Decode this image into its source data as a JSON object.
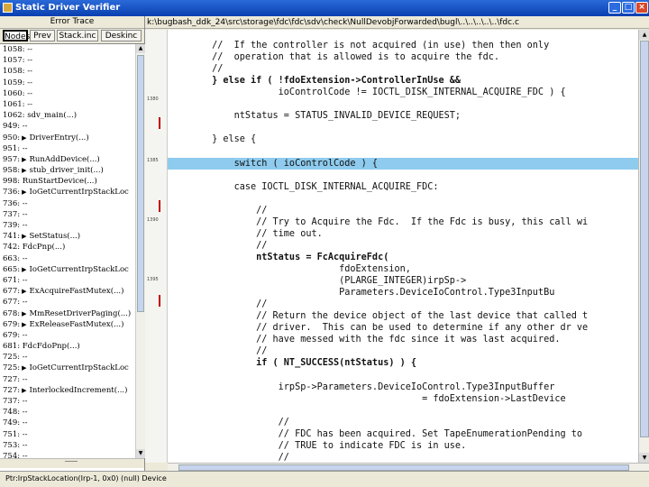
{
  "window": {
    "title": "Static Driver Verifier",
    "min_label": "_",
    "max_label": "□",
    "close_label": "×"
  },
  "left_panel": {
    "header": "Error Trace",
    "tabs": [
      {
        "label": "Nodes",
        "active": true
      },
      {
        "label": "Prev",
        "active": false
      },
      {
        "label": "Stack.inc",
        "active": false
      },
      {
        "label": "Deskinc",
        "active": false
      }
    ],
    "trace": [
      {
        "text": "1058: --",
        "arrow": false
      },
      {
        "text": "1057: --",
        "arrow": false
      },
      {
        "text": "1058: --",
        "arrow": false
      },
      {
        "text": "1059: --",
        "arrow": false
      },
      {
        "text": "1060: --",
        "arrow": false
      },
      {
        "text": "1061: --",
        "arrow": false
      },
      {
        "text": "1062: sdv_main(...)",
        "arrow": false
      },
      {
        "text": "949: --",
        "arrow": false
      },
      {
        "text": "950:",
        "arrow": true,
        "call": "DriverEntry(...)"
      },
      {
        "text": "951: --",
        "arrow": false
      },
      {
        "text": "957:",
        "arrow": true,
        "call": "RunAddDevice(...)"
      },
      {
        "text": "958:",
        "arrow": true,
        "call": "stub_driver_init(...)"
      },
      {
        "text": "998: RunStartDevice(...)",
        "arrow": false
      },
      {
        "text": "736:",
        "arrow": true,
        "call": "IoGetCurrentIrpStackLoc"
      },
      {
        "text": "736: --",
        "arrow": false
      },
      {
        "text": "737: --",
        "arrow": false
      },
      {
        "text": "739: --",
        "arrow": false
      },
      {
        "text": "741:",
        "arrow": true,
        "call": "SetStatus(...)"
      },
      {
        "text": "742: FdcPnp(...)",
        "arrow": false
      },
      {
        "text": "663: --",
        "arrow": false
      },
      {
        "text": "665:",
        "arrow": true,
        "call": "IoGetCurrentIrpStackLoc"
      },
      {
        "text": "671: --",
        "arrow": false
      },
      {
        "text": "677:",
        "arrow": true,
        "call": "ExAcquireFastMutex(...)"
      },
      {
        "text": "677: --",
        "arrow": false
      },
      {
        "text": "678:",
        "arrow": true,
        "call": "MmResetDriverPaging(...)"
      },
      {
        "text": "679:",
        "arrow": true,
        "call": "ExReleaseFastMutex(...)"
      },
      {
        "text": "679: --",
        "arrow": false
      },
      {
        "text": "681: FdcFdoPnp(...)",
        "arrow": false
      },
      {
        "text": "725: --",
        "arrow": false
      },
      {
        "text": "725:",
        "arrow": true,
        "call": "IoGetCurrentIrpStackLoc"
      },
      {
        "text": "727: --",
        "arrow": false
      },
      {
        "text": "727:",
        "arrow": true,
        "call": "InterlockedIncrement(...)"
      },
      {
        "text": "737: --",
        "arrow": false
      },
      {
        "text": "748: --",
        "arrow": false
      },
      {
        "text": "749: --",
        "arrow": false
      },
      {
        "text": "751: --",
        "arrow": false
      },
      {
        "text": "753: --",
        "arrow": false
      },
      {
        "text": "754: --",
        "arrow": false
      }
    ]
  },
  "path": "k:\\bugbash_ddk_24\\src\\storage\\fdc\\fdc\\sdv\\check\\NullDevobjForwarded\\bugl\\..\\..\\..\\..\\..\\fdc.c",
  "gutter": {
    "line_numbers": [
      "1380",
      "1385",
      "1390",
      "1395"
    ],
    "marks": 3
  },
  "code": [
    {
      "text": "        //  If the controller is not acquired (in use) then then only",
      "hl": false,
      "bold": false
    },
    {
      "text": "        //  operation that is allowed is to acquire the fdc.",
      "hl": false,
      "bold": false
    },
    {
      "text": "        //",
      "hl": false,
      "bold": false
    },
    {
      "text": "        } else if ( !fdoExtension->ControllerInUse &&",
      "hl": false,
      "bold": true
    },
    {
      "text": "                    ioControlCode != IOCTL_DISK_INTERNAL_ACQUIRE_FDC ) {",
      "hl": false,
      "bold": false
    },
    {
      "text": "",
      "hl": false,
      "bold": false
    },
    {
      "text": "            ntStatus = STATUS_INVALID_DEVICE_REQUEST;",
      "hl": false,
      "bold": false
    },
    {
      "text": "",
      "hl": false,
      "bold": false
    },
    {
      "text": "        } else {",
      "hl": false,
      "bold": false
    },
    {
      "text": "",
      "hl": false,
      "bold": false
    },
    {
      "text": "            switch ( ioControlCode ) {",
      "hl": true,
      "bold": false
    },
    {
      "text": "",
      "hl": false,
      "bold": false
    },
    {
      "text": "            case IOCTL_DISK_INTERNAL_ACQUIRE_FDC:",
      "hl": false,
      "bold": false
    },
    {
      "text": "",
      "hl": false,
      "bold": false
    },
    {
      "text": "                //",
      "hl": false,
      "bold": false
    },
    {
      "text": "                // Try to Acquire the Fdc.  If the Fdc is busy, this call wi",
      "hl": false,
      "bold": false
    },
    {
      "text": "                // time out.",
      "hl": false,
      "bold": false
    },
    {
      "text": "                //",
      "hl": false,
      "bold": false
    },
    {
      "text": "                ntStatus = FcAcquireFdc(",
      "hl": false,
      "bold": true
    },
    {
      "text": "                               fdoExtension,",
      "hl": false,
      "bold": false
    },
    {
      "text": "                               (PLARGE_INTEGER)irpSp->",
      "hl": false,
      "bold": false
    },
    {
      "text": "                               Parameters.DeviceIoControl.Type3InputBu",
      "hl": false,
      "bold": false
    },
    {
      "text": "                //",
      "hl": false,
      "bold": false
    },
    {
      "text": "                // Return the device object of the last device that called t",
      "hl": false,
      "bold": false
    },
    {
      "text": "                // driver.  This can be used to determine if any other dr ve",
      "hl": false,
      "bold": false
    },
    {
      "text": "                // have messed with the fdc since it was last acquired.",
      "hl": false,
      "bold": false
    },
    {
      "text": "                //",
      "hl": false,
      "bold": false
    },
    {
      "text": "                if ( NT_SUCCESS(ntStatus) ) {",
      "hl": false,
      "bold": true
    },
    {
      "text": "",
      "hl": false,
      "bold": false
    },
    {
      "text": "                    irpSp->Parameters.DeviceIoControl.Type3InputBuffer",
      "hl": false,
      "bold": false
    },
    {
      "text": "                                              = fdoExtension->LastDevice",
      "hl": false,
      "bold": false
    },
    {
      "text": "",
      "hl": false,
      "bold": false
    },
    {
      "text": "                    //",
      "hl": false,
      "bold": false
    },
    {
      "text": "                    // FDC has been acquired. Set TapeEnumerationPending to",
      "hl": false,
      "bold": false
    },
    {
      "text": "                    // TRUE to indicate FDC is in use.",
      "hl": false,
      "bold": false
    },
    {
      "text": "                    //",
      "hl": false,
      "bold": false
    }
  ],
  "status": "Ptr:IrpStackLocation(Irp-1, 0x0) (null) Device"
}
